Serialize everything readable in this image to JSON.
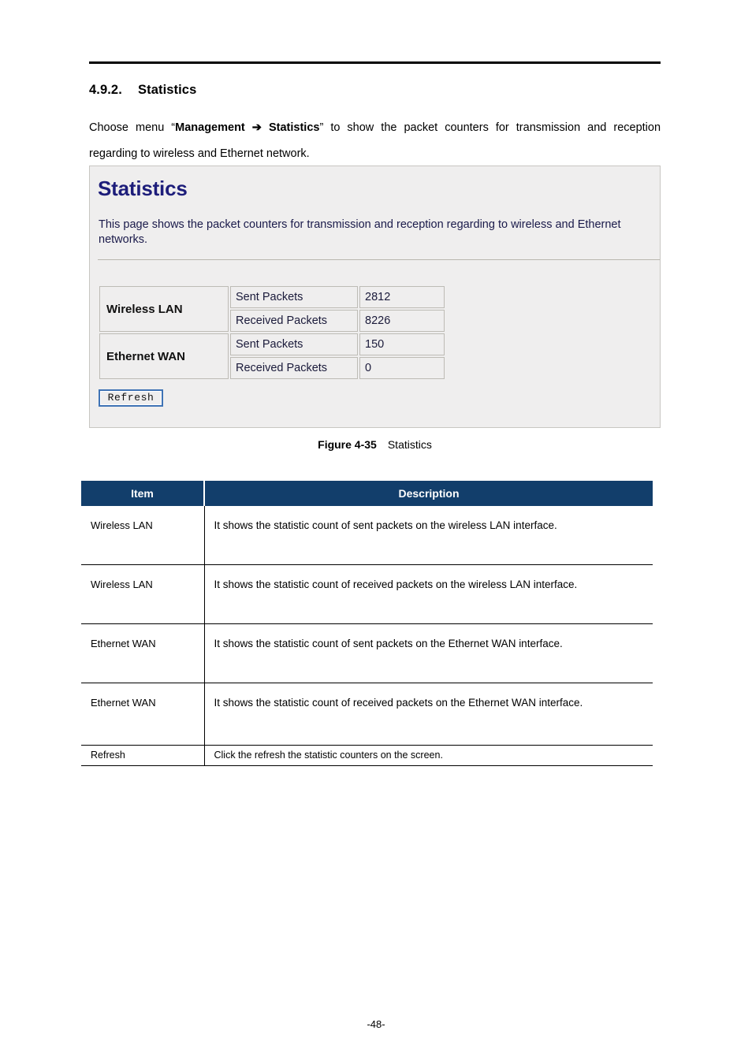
{
  "document": {
    "section_number": "4.9.2.",
    "section_title": "Statistics",
    "intro_before": "Choose menu “",
    "intro_bold1": "Management",
    "intro_arrow": "➔",
    "intro_bold2": "Statistics",
    "intro_after": "” to show the packet counters for transmission and reception regarding to wireless and Ethernet network.",
    "page_number": "-48-"
  },
  "figure": {
    "title": "Statistics",
    "description": "This page shows the packet counters for transmission and reception regarding to wireless and Ethernet networks.",
    "caption_label": "Figure 4-35",
    "caption_text": "Statistics",
    "refresh_button": "Refresh",
    "stats": [
      {
        "interface": "Wireless LAN",
        "rows": [
          {
            "label": "Sent Packets",
            "value": "2812"
          },
          {
            "label": "Received Packets",
            "value": "8226"
          }
        ]
      },
      {
        "interface": "Ethernet WAN",
        "rows": [
          {
            "label": "Sent Packets",
            "value": "150"
          },
          {
            "label": "Received Packets",
            "value": "0"
          }
        ]
      }
    ]
  },
  "description_table": {
    "headers": {
      "item": "Item",
      "description": "Description"
    },
    "rows": [
      {
        "item": "Wireless LAN",
        "description": "It shows the statistic count of sent packets on the wireless LAN interface."
      },
      {
        "item": "Wireless LAN",
        "description": "It shows the statistic count of received packets on the wireless LAN interface."
      },
      {
        "item": "Ethernet WAN",
        "description": "It shows the statistic count of sent packets on the Ethernet WAN interface."
      },
      {
        "item": "Ethernet WAN",
        "description": "It shows the statistic count of received packets on the Ethernet WAN interface."
      },
      {
        "item": "Refresh",
        "description": "Click the refresh the statistic counters on the screen."
      }
    ]
  },
  "colors": {
    "table_header_bg": "#123e6b",
    "figure_title": "#1d1d7a",
    "figure_bg": "#efeeee",
    "button_focus_border": "#3f73b5"
  }
}
